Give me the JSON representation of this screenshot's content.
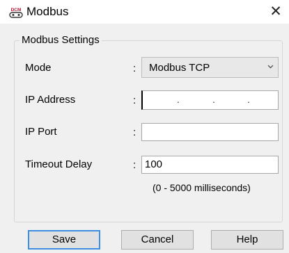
{
  "window": {
    "title": "Modbus",
    "close_glyph": "✕",
    "icon_text": "DCM",
    "icon_name": "dcm-plug-icon"
  },
  "group": {
    "legend": "Modbus Settings"
  },
  "fields": {
    "mode": {
      "label": "Mode",
      "colon": ":",
      "value": "Modbus TCP"
    },
    "ip_address": {
      "label": "IP Address",
      "colon": ":",
      "value": "",
      "dot": "."
    },
    "ip_port": {
      "label": "IP Port",
      "colon": ":",
      "value": ""
    },
    "timeout": {
      "label": "Timeout Delay",
      "colon": ":",
      "value": "100",
      "hint": "(0 - 5000 milliseconds)"
    }
  },
  "buttons": {
    "save": "Save",
    "cancel": "Cancel",
    "help": "Help"
  },
  "colors": {
    "brand_red": "#c8102e",
    "default_button_border": "#3c8fe0",
    "client_background": "#f0f0f0"
  }
}
